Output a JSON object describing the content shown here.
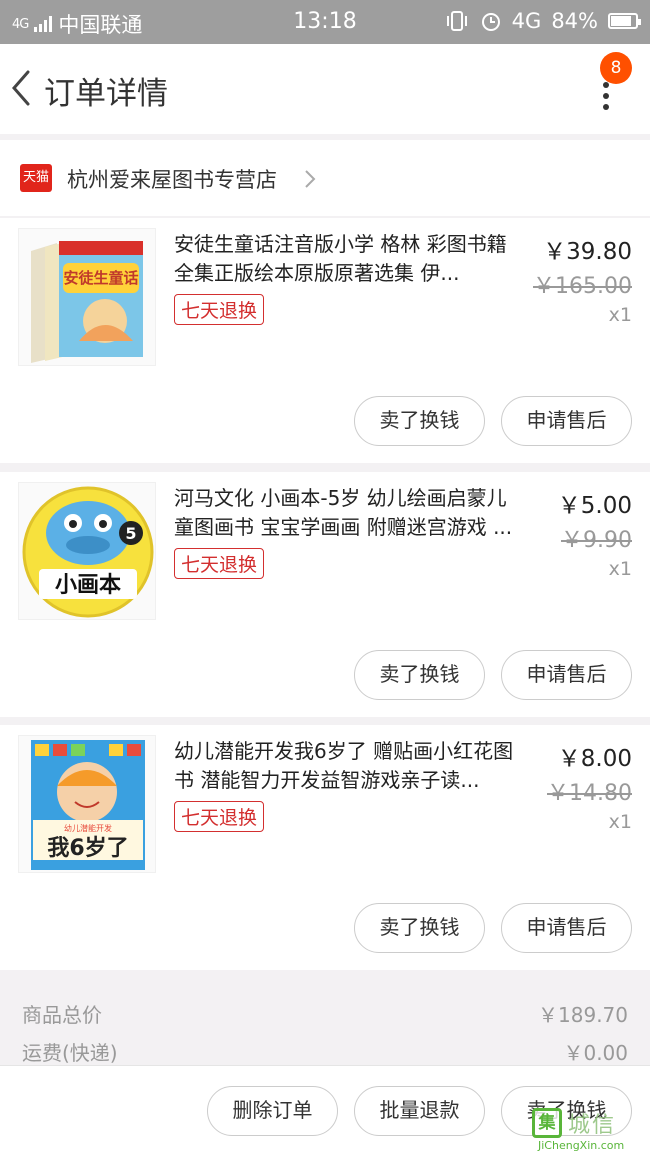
{
  "status_bar": {
    "network_type": "4G",
    "carrier": "中国联通",
    "time": "13:18",
    "data_type": "4G",
    "battery": "84%",
    "battery_level": 0.84
  },
  "header": {
    "title": "订单详情",
    "badge_count": "8"
  },
  "store": {
    "badge": "天猫",
    "name": "杭州爱来屋图书专营店"
  },
  "items": [
    {
      "name": "安徒生童话注音版小学 格林 彩图书籍 全集正版绘本原版原著选集 伊...",
      "tag": "七天退换",
      "price": "￥39.80",
      "original_price": "￥165.00",
      "quantity": "x1",
      "sell_label": "卖了换钱",
      "after_sale_label": "申请售后",
      "cover_text": "安徒生童话"
    },
    {
      "name": "河马文化 小画本-5岁 幼儿绘画启蒙儿童图画书 宝宝学画画 附赠迷宫游戏 ...",
      "tag": "七天退换",
      "price": "￥5.00",
      "original_price": "￥9.90",
      "quantity": "x1",
      "sell_label": "卖了换钱",
      "after_sale_label": "申请售后",
      "cover_text": "小画本",
      "cover_number": "5"
    },
    {
      "name": "幼儿潜能开发我6岁了 赠贴画小红花图书 潜能智力开发益智游戏亲子读...",
      "tag": "七天退换",
      "price": "￥8.00",
      "original_price": "￥14.80",
      "quantity": "x1",
      "sell_label": "卖了换钱",
      "after_sale_label": "申请售后",
      "cover_text": "我6岁了",
      "cover_subtext": "幼儿潜能开发"
    }
  ],
  "summary": {
    "goods_total_label": "商品总价",
    "goods_total_value": "￥189.70",
    "shipping_label": "运费(快递)",
    "shipping_value": "￥0.00"
  },
  "footer": {
    "delete_label": "删除订单",
    "batch_refund_label": "批量退款",
    "sell_label": "卖了换钱"
  },
  "watermark": {
    "logo": "集",
    "text": "城信",
    "url": "JiChengXin.com"
  },
  "colors": {
    "accent": "#ff5000",
    "tmall_red": "#e1251b",
    "tag_red": "#d32f2f",
    "status_bar": "#9e9e9e"
  }
}
